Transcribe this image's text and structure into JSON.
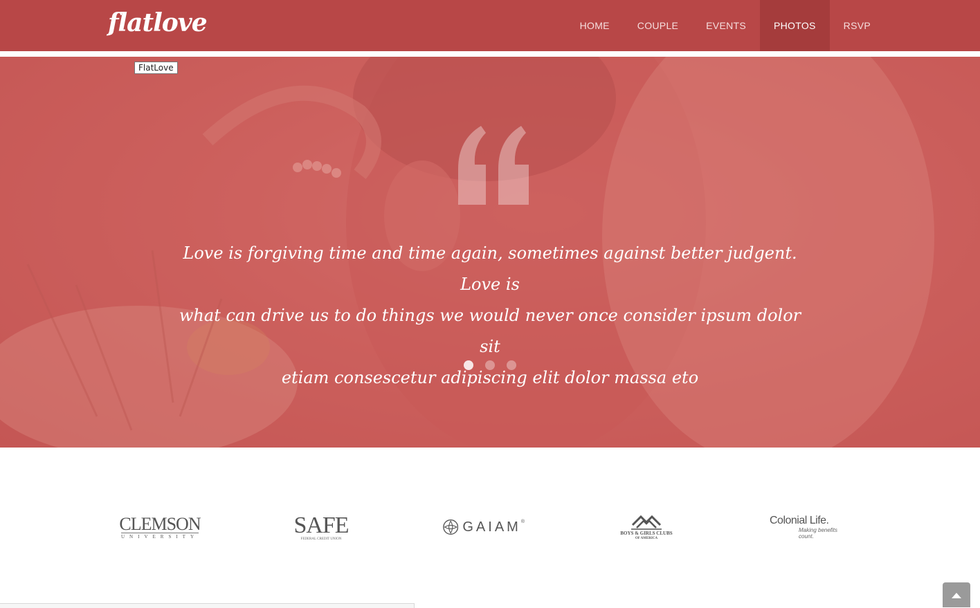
{
  "brand": {
    "logo_text": "flatlove",
    "tooltip": "FlatLove"
  },
  "nav": {
    "items": [
      {
        "label": "HOME",
        "active": false
      },
      {
        "label": "COUPLE",
        "active": false
      },
      {
        "label": "EVENTS",
        "active": false
      },
      {
        "label": "PHOTOS",
        "active": true
      },
      {
        "label": "RSVP",
        "active": false
      }
    ]
  },
  "hero": {
    "quote_lines": [
      "Love is forgiving time and time again, sometimes against better judgent. Love is",
      "what can drive us to do things we would never once consider ipsum dolor sit",
      "etiam consescetur adipiscing elit dolor massa eto"
    ],
    "slides": 3,
    "active_slide": 1,
    "background_image": "couple-forehead-to-forehead-photo"
  },
  "partners": {
    "clemson": {
      "name": "CLEMSON",
      "sub": "UNIVERSITY"
    },
    "safe": {
      "name": "SAFE",
      "sub": "FEDERAL CREDIT UNION"
    },
    "gaiam": {
      "name": "GAIAM",
      "mark": "®"
    },
    "bgc": {
      "line1": "BOYS & GIRLS CLUBS",
      "line2": "OF AMERICA"
    },
    "colonial": {
      "name": "Colonial Life.",
      "tagline": "Making benefits count."
    }
  },
  "colors": {
    "header_bg": "#b84747",
    "header_active": "#a53c3c",
    "hero_tint": "#cf6a67",
    "scroll_button": "#9a9a9a"
  },
  "icons": {
    "quote": "quote-open-icon",
    "scroll_top": "chevron-up-icon"
  }
}
